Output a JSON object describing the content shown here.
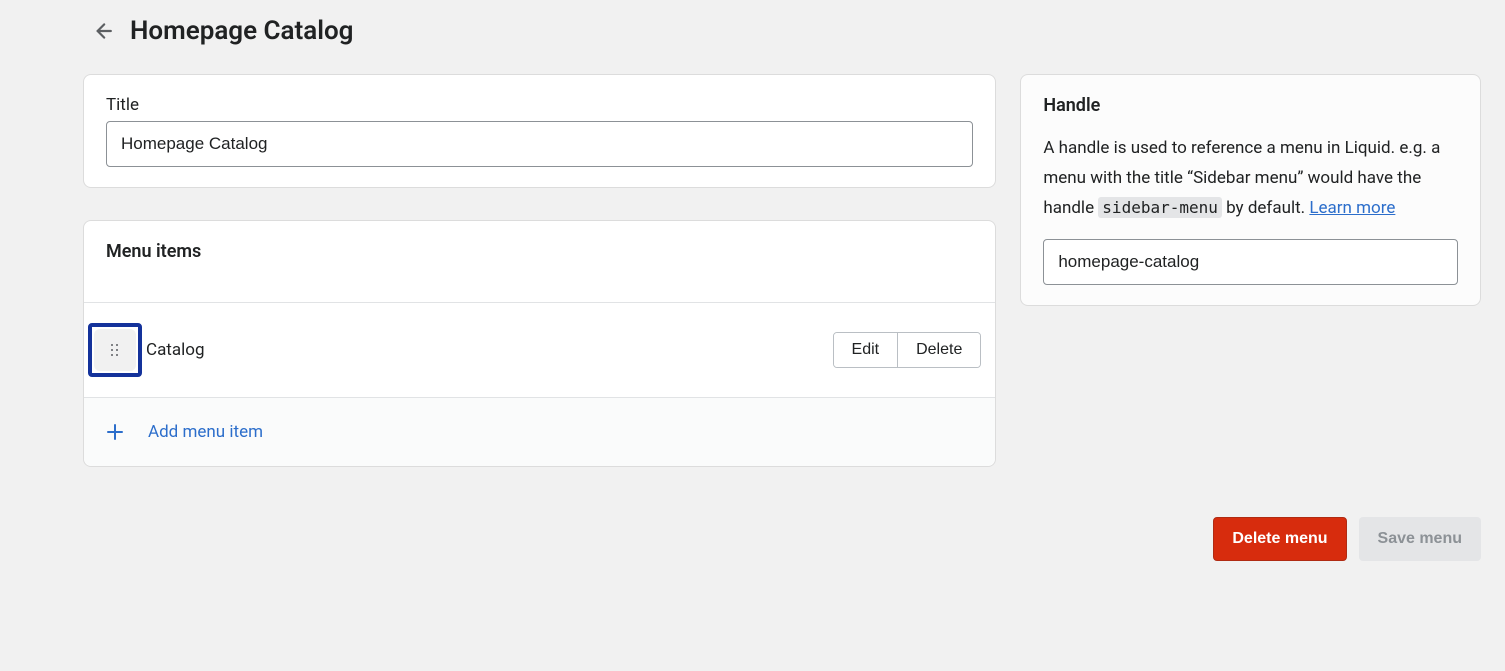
{
  "header": {
    "title": "Homepage Catalog"
  },
  "title_card": {
    "label": "Title",
    "value": "Homepage Catalog"
  },
  "menu_items_card": {
    "heading": "Menu items",
    "items": [
      {
        "label": "Catalog"
      }
    ],
    "edit_label": "Edit",
    "delete_label": "Delete",
    "add_label": "Add menu item"
  },
  "handle_card": {
    "heading": "Handle",
    "desc_part1": "A handle is used to reference a menu in Liquid. e.g. a menu with the title “Sidebar menu” would have the handle ",
    "desc_code": "sidebar-menu",
    "desc_part2": " by default. ",
    "learn_more": "Learn more",
    "value": "homepage-catalog"
  },
  "footer": {
    "delete": "Delete menu",
    "save": "Save menu"
  }
}
